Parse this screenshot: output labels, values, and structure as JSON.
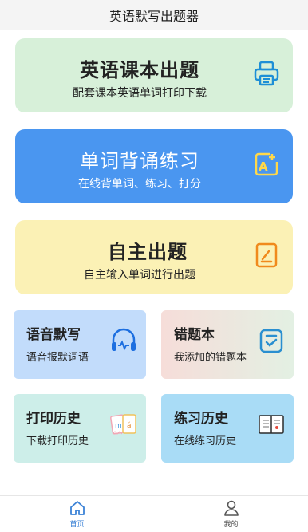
{
  "header": {
    "title": "英语默写出题器"
  },
  "cards": [
    {
      "title": "英语课本出题",
      "subtitle": "配套课本英语单词打印下载",
      "icon": "printer-icon"
    },
    {
      "title": "单词背诵练习",
      "subtitle": "在线背单词、练习、打分",
      "icon": "edit-text-icon"
    },
    {
      "title": "自主出题",
      "subtitle": "自主输入单词进行出题",
      "icon": "note-edit-icon"
    }
  ],
  "tiles": [
    {
      "title": "语音默写",
      "subtitle": "语音报默词语",
      "icon": "headphones-icon"
    },
    {
      "title": "错题本",
      "subtitle": "我添加的错题本",
      "icon": "checklist-icon"
    },
    {
      "title": "打印历史",
      "subtitle": "下载打印历史",
      "icon": "cards-icon"
    },
    {
      "title": "练习历史",
      "subtitle": "在线练习历史",
      "icon": "notebook-icon"
    }
  ],
  "tabbar": {
    "items": [
      {
        "label": "首页",
        "icon": "home-icon",
        "active": true
      },
      {
        "label": "我的",
        "icon": "user-icon",
        "active": false
      }
    ]
  },
  "colors": {
    "accent": "#3b82d6",
    "card_green": "#d7f0d9",
    "card_blue": "#4a96f0",
    "card_yellow": "#fbf1b5"
  }
}
